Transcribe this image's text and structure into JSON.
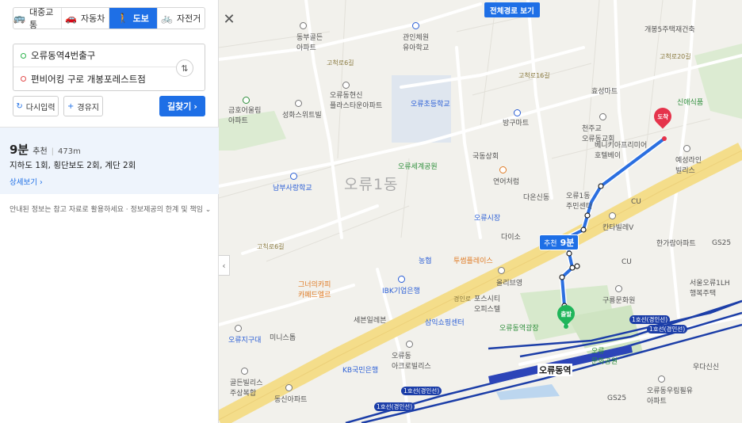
{
  "modes": [
    {
      "label": "대중교통",
      "icon": "bus-icon",
      "glyph": "🚌"
    },
    {
      "label": "자동차",
      "icon": "car-icon",
      "glyph": "🚗"
    },
    {
      "label": "도보",
      "icon": "walk-icon",
      "glyph": "🚶"
    },
    {
      "label": "자전거",
      "icon": "bicycle-icon",
      "glyph": "🚲"
    }
  ],
  "close_glyph": "✕",
  "search": {
    "origin": "오류동역4번출구",
    "destination": "편비어킹 구로 개봉포레스트점",
    "swap_glyph": "⇅"
  },
  "buttons": {
    "reset": "다시입력",
    "reset_glyph": "↻",
    "via": "경유지",
    "via_glyph": "+",
    "find": "길찾기",
    "find_glyph": "›"
  },
  "result": {
    "time": "9분",
    "recommend": "추천",
    "separator": "|",
    "distance": "473m",
    "desc": "지하도 1회, 횡단보도 2회, 계단 2회",
    "more": "상세보기 ›"
  },
  "notice": "안내된 정보는 참고 자료로 활용하세요 · 정보제공의 한계 및 책임 ⌄",
  "collapse_glyph": "‹",
  "map": {
    "full_route": "전체경로 보기",
    "dest_pin": "도착",
    "start_pin": "출발",
    "route_badge_rec": "추천",
    "route_badge_time": "9분",
    "district": "오류1동",
    "station": "오류동역",
    "labels": {
      "gochuk_apt": "동부골든\n아파트",
      "gwanin": "관인체원\n유아학교",
      "ohrudong_plaza": "오류동현신\n플라스타운아파트",
      "ohruelem": "오류초등학교",
      "gaebong": "개봉5주택재건축",
      "hyoseong": "효성마트",
      "bangju": "방구마트",
      "cheonju": "천주교\n오류동교회",
      "sinae": "신애식품",
      "gohoapt": "금호어울림\n아파트",
      "seongho": "성화스위트빌",
      "kuksa": "국동상회",
      "ohruse": "오류세계공원",
      "yeoneo": "연어처럼",
      "dasin": "다온신동",
      "ohru1center": "오류1동\n주민센터",
      "cu1": "CU",
      "bnvill": "베니키아프리미어\n호텔베이",
      "yesung": "예성라인\n빌리스",
      "namseong": "남부사랑학교",
      "ohrumart": "오류시장",
      "dadaiso": "다이소",
      "kantavill": "칸타빌레V",
      "hanjul": "한가람아파트",
      "gs25a": "GS25",
      "nonghyup": "농협",
      "tuseung": "투썸플레이스",
      "cu2": "CU",
      "ibk": "IBK기업은행",
      "olive": "올리브영",
      "guryong": "구룡문화원",
      "seoul1lh": "서울오류1LH\n행복주택",
      "gurupi": "그너의카피\n카페드엘르",
      "possity": "포스시티\n오피스텔",
      "seven": "세븐일레븐",
      "samik": "삼익쇼핑센터",
      "ohruplaza": "오류동역광장",
      "minis": "미니스톱",
      "ohrujigudae": "오류지구대",
      "kb": "KB국민은행",
      "ohruacro": "오류동\n아크로빌리스",
      "ohru_culture": "오류\n문화공원",
      "gs25b": "GS25",
      "ohru_woorim": "오류동우림필유\n아파트",
      "woodasin": "우다신신",
      "goldenvill": "골든빌리스\n주상복합",
      "dongsin": "동신아파트",
      "line1a": "1호선(경인선)",
      "line1b": "1호선(경인선)",
      "line1c": "1호선(경인선)",
      "line1d": "1호선(경인선)",
      "road_gyeongin": "경인로",
      "road_gochuk6": "고척로6길",
      "road_gochuk16": "고척로16길",
      "road_gochuk20": "고척로20길",
      "road_gochuk6b": "고척로6길"
    }
  },
  "colors": {
    "accent": "#1e6fe6",
    "route": "#2b6fe0",
    "subway": "#1c3ea8",
    "dest": "#e5334b",
    "start": "#1fb55a",
    "arterial": "#f2dc8a"
  }
}
